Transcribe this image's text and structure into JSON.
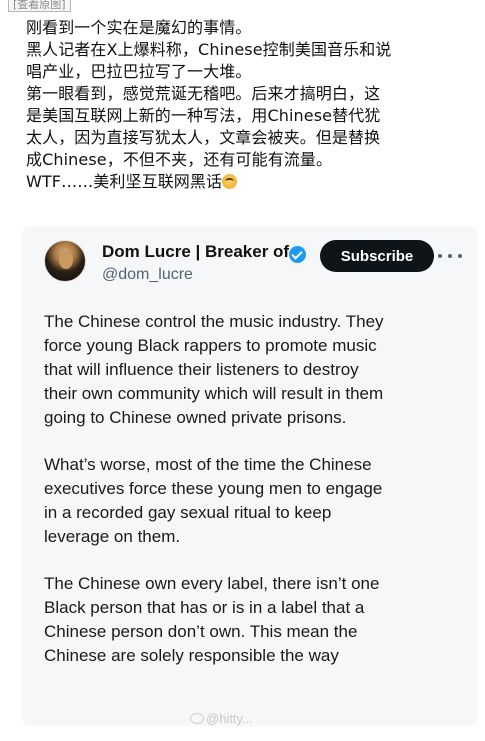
{
  "header": {
    "view_original": "[查看原图]"
  },
  "post": {
    "lines": [
      "刚看到一个实在是魔幻的事情。",
      "黑人记者在X上爆料称，Chinese控制美国音乐和说",
      "唱产业，巴拉巴拉写了一大堆。",
      "第一眼看到，感觉荒诞无稽吧。后来才搞明白，这",
      "是美国互联网上新的一种写法，用Chinese替代犹",
      "太人，因为直接写犹太人，文章会被夹。但是替换",
      "成Chinese，不但不夹，还有可能有流量。",
      "WTF……美利坚互联网黑话"
    ],
    "emoji_icon": "dizzy-face-emoji"
  },
  "tweet": {
    "author_name": "Dom Lucre | Breaker of",
    "handle": "@dom_lucre",
    "subscribe_label": "Subscribe",
    "verified_color": "#1d9bf0",
    "paragraphs": [
      [
        "The Chinese control the music industry. They",
        "force young Black rappers to promote music",
        "that will influence their listeners to destroy",
        "their own community which will result in them",
        "going to Chinese owned private prisons."
      ],
      [
        "What’s worse, most of the time the Chinese",
        "executives force these young men to engage",
        "in a recorded gay sexual ritual to keep",
        "leverage on them."
      ],
      [
        "The Chinese own every label, there isn’t one",
        "Black person that has or is in a label that a",
        "Chinese person don’t own. This mean the",
        "Chinese are solely responsible the way"
      ]
    ]
  },
  "watermark": {
    "text": "@hitty..."
  }
}
